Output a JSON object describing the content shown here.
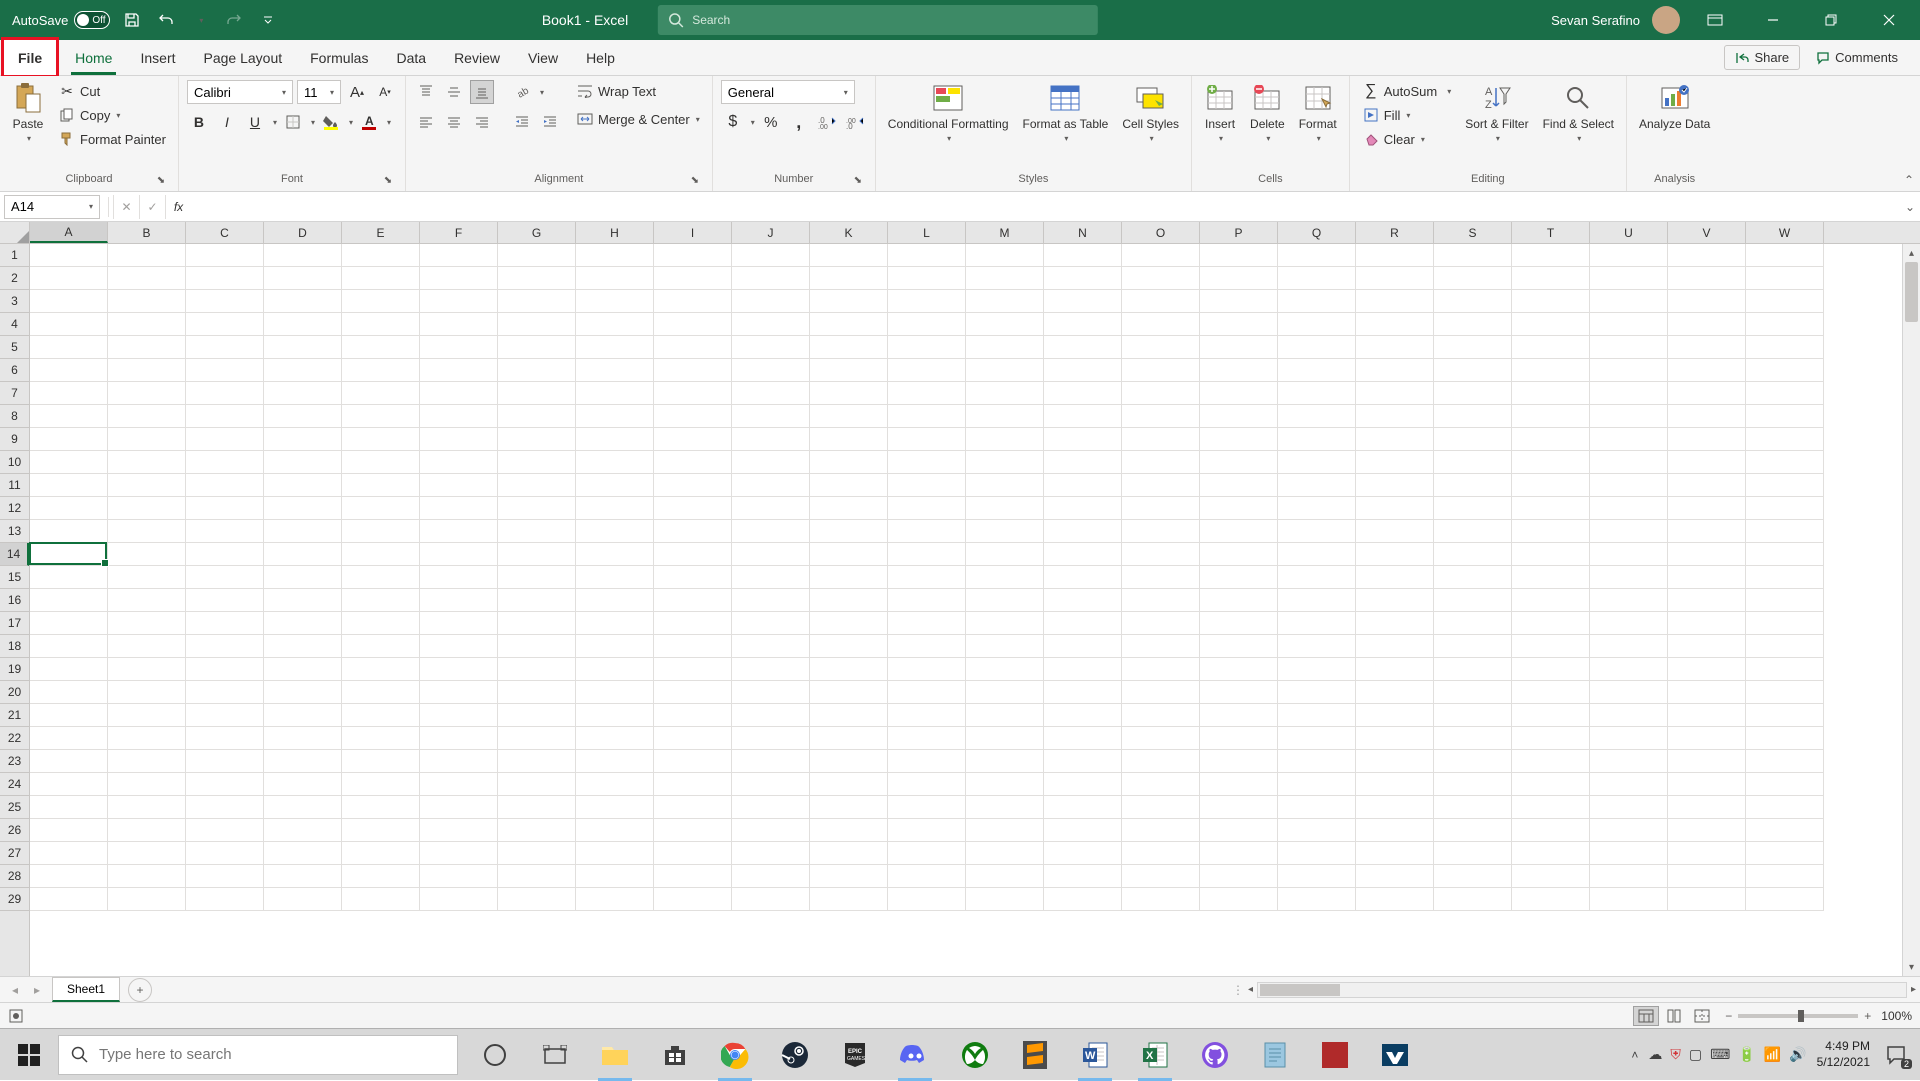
{
  "titlebar": {
    "autosave_label": "AutoSave",
    "autosave_state": "Off",
    "doc_title": "Book1  -  Excel",
    "search_placeholder": "Search",
    "user_name": "Sevan Serafino"
  },
  "tabs": {
    "file": "File",
    "home": "Home",
    "insert": "Insert",
    "page_layout": "Page Layout",
    "formulas": "Formulas",
    "data": "Data",
    "review": "Review",
    "view": "View",
    "help": "Help",
    "share": "Share",
    "comments": "Comments"
  },
  "ribbon": {
    "clipboard": {
      "paste": "Paste",
      "cut": "Cut",
      "copy": "Copy",
      "format_painter": "Format Painter",
      "label": "Clipboard"
    },
    "font": {
      "name": "Calibri",
      "size": "11",
      "label": "Font"
    },
    "alignment": {
      "wrap_text": "Wrap Text",
      "merge_center": "Merge & Center",
      "label": "Alignment"
    },
    "number": {
      "format": "General",
      "label": "Number"
    },
    "styles": {
      "conditional": "Conditional Formatting",
      "format_table": "Format as Table",
      "cell_styles": "Cell Styles",
      "label": "Styles"
    },
    "cells": {
      "insert": "Insert",
      "delete": "Delete",
      "format": "Format",
      "label": "Cells"
    },
    "editing": {
      "autosum": "AutoSum",
      "fill": "Fill",
      "clear": "Clear",
      "sort_filter": "Sort & Filter",
      "find_select": "Find & Select",
      "label": "Editing"
    },
    "analysis": {
      "analyze": "Analyze Data",
      "label": "Analysis"
    }
  },
  "formula_bar": {
    "name_box": "A14",
    "formula": ""
  },
  "grid": {
    "columns": [
      "A",
      "B",
      "C",
      "D",
      "E",
      "F",
      "G",
      "H",
      "I",
      "J",
      "K",
      "L",
      "M",
      "N",
      "O",
      "P",
      "Q",
      "R",
      "S",
      "T",
      "U",
      "V",
      "W"
    ],
    "rows": [
      1,
      2,
      3,
      4,
      5,
      6,
      7,
      8,
      9,
      10,
      11,
      12,
      13,
      14,
      15,
      16,
      17,
      18,
      19,
      20,
      21,
      22,
      23,
      24,
      25,
      26,
      27,
      28,
      29
    ],
    "selected_col": "A",
    "selected_row": 14,
    "active_cell": "A14"
  },
  "sheets": {
    "active": "Sheet1"
  },
  "status": {
    "zoom": "100%"
  },
  "taskbar": {
    "search_placeholder": "Type here to search",
    "time": "4:49 PM",
    "date": "5/12/2021",
    "notif_count": "2"
  }
}
